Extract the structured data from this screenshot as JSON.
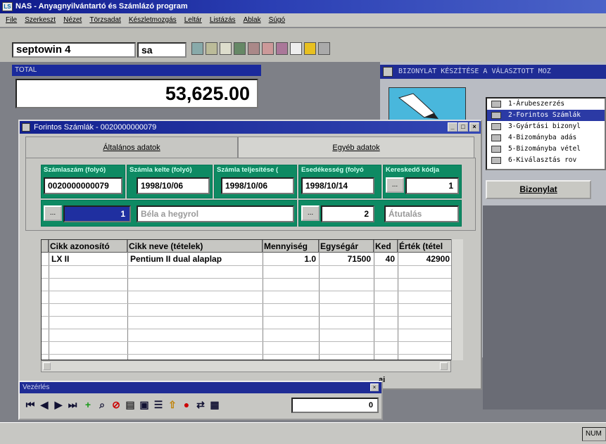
{
  "app": {
    "title": "NAS - Anyagnyilvántartó és Számlázó program",
    "icon_label": "LS"
  },
  "menu": [
    "File",
    "Szerkeszt",
    "Nézet",
    "Törzsadat",
    "Készletmozgás",
    "Leltár",
    "Listázás",
    "Ablak",
    "Súgó"
  ],
  "toolbar": {
    "user": "septowin 4",
    "session": "sa"
  },
  "total": {
    "label": "TOTAL",
    "value": "53,625.00"
  },
  "doc_panel": {
    "title": "BIZONYLAT KÉSZÍTÉSE A VÁLASZTOTT MOZ",
    "items": [
      "1-Árubeszerzés",
      "2-Forintos Számlák",
      "3-Gyártási bizonyl",
      "4-Bizományba adás",
      "5-Bizományba vétel",
      "6-Kiválasztás rov"
    ],
    "selected": 1,
    "button": "Bizonylat"
  },
  "invoice_window": {
    "title": "Forintos Számlák - 0020000000079",
    "tabs": [
      "Általános adatok",
      "Egyéb adatok"
    ],
    "fields": {
      "invoice_no_label": "Számlaszám (folyó)",
      "invoice_no": "0020000000079",
      "date_label": "Számla kelte (folyó)",
      "date": "1998/10/06",
      "fulfil_label": "Számla teljesítése (",
      "fulfil": "1998/10/06",
      "due_label": "Esedékesség (folyó",
      "due": "1998/10/14",
      "dealer_label": "Kereskedő kódja",
      "dealer": "1",
      "partner_code": "1",
      "partner_name": "Béla a hegyrol",
      "payment_code": "2",
      "payment_name": "Átutalás",
      "btn_dots": "..."
    },
    "grid": {
      "headers": [
        "Cikk azonosító",
        "Cikk neve (tételek)",
        "Mennyiség",
        "Egységár",
        "Ked",
        "Érték (tétel"
      ],
      "rows": [
        [
          "LX II",
          "Pentium II dual alaplap",
          "1.0",
          "71500",
          "40",
          "42900"
        ]
      ]
    },
    "bottom_hint": "ai"
  },
  "control": {
    "title": "Vezérlés",
    "record": "0"
  },
  "status": {
    "num": "NUM"
  },
  "colors": {
    "title_blue": "#13218f",
    "green_group": "#0e8a63",
    "selection": "#2b3aa5"
  }
}
